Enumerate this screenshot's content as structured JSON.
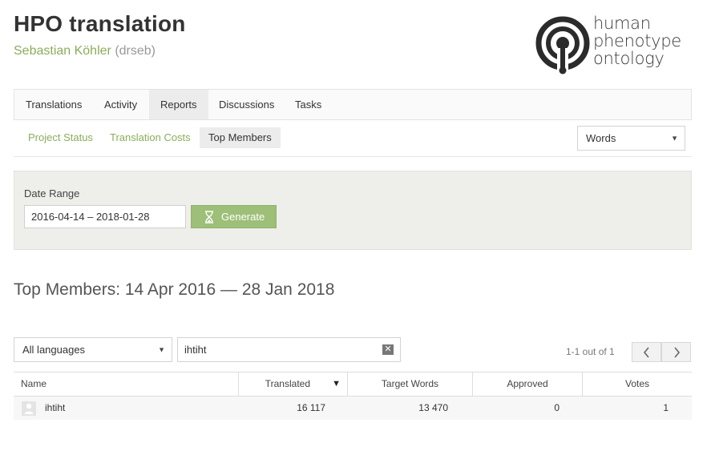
{
  "header": {
    "title": "HPO translation",
    "user_name": "Sebastian Köhler",
    "user_login": "(drseb)",
    "logo_lines": [
      "human",
      "phenotype",
      "ontology"
    ]
  },
  "tabs": [
    {
      "label": "Translations",
      "active": false
    },
    {
      "label": "Activity",
      "active": false
    },
    {
      "label": "Reports",
      "active": true
    },
    {
      "label": "Discussions",
      "active": false
    },
    {
      "label": "Tasks",
      "active": false
    }
  ],
  "subtabs": [
    {
      "label": "Project Status",
      "active": false
    },
    {
      "label": "Translation Costs",
      "active": false
    },
    {
      "label": "Top Members",
      "active": true
    }
  ],
  "unit_select": {
    "value": "Words"
  },
  "filter": {
    "date_range_label": "Date Range",
    "date_range_value": "2016-04-14 – 2018-01-28",
    "generate_label": "Generate"
  },
  "report": {
    "heading": "Top Members: 14 Apr 2016 — 28 Jan 2018"
  },
  "language_select": {
    "value": "All languages"
  },
  "search": {
    "value": "ihtiht"
  },
  "pager": {
    "text": "1-1 out of 1"
  },
  "table": {
    "columns": [
      "Name",
      "Translated",
      "Target Words",
      "Approved",
      "Votes"
    ],
    "sort_indicator": "▼",
    "rows": [
      {
        "name": "ihtiht",
        "translated": "16 117",
        "target_words": "13 470",
        "approved": "0",
        "votes": "1"
      }
    ]
  },
  "colors": {
    "accent_green": "#8aad5a",
    "button_green": "#9dbf77"
  }
}
